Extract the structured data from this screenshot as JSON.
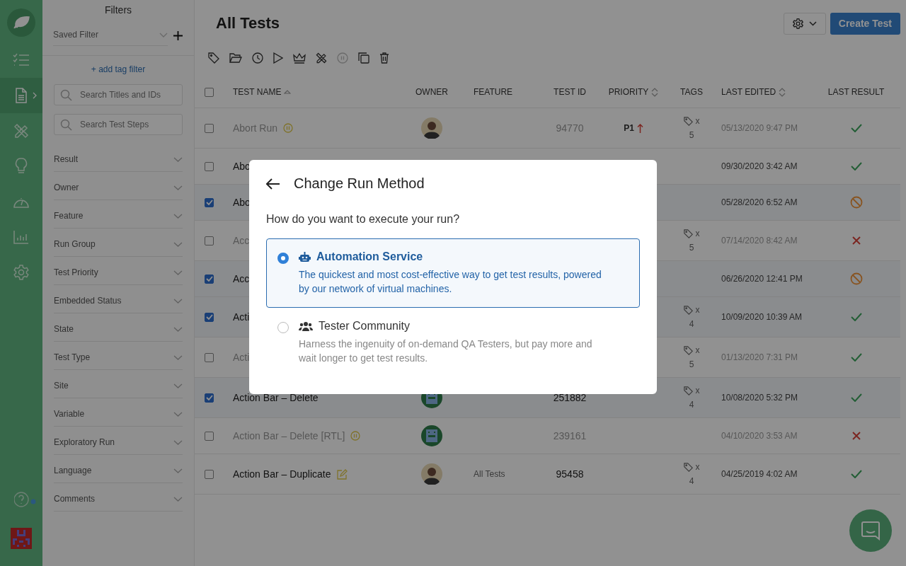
{
  "nav": [
    {
      "selected": false
    },
    {
      "selected": true
    },
    {
      "selected": false
    },
    {
      "selected": false
    },
    {
      "selected": false
    },
    {
      "selected": false
    },
    {
      "selected": false
    }
  ],
  "filters": {
    "title": "Filters",
    "saved_filter": "Saved Filter",
    "add_tag": "+ add tag filter",
    "searches": [
      {
        "placeholder": "Search Titles and IDs"
      },
      {
        "placeholder": "Search Test Steps"
      }
    ],
    "facets": [
      "Result",
      "Owner",
      "Feature",
      "Run Group",
      "Test Priority",
      "Embedded Status",
      "State",
      "Test Type",
      "Site",
      "Variable",
      "Exploratory Run",
      "Language",
      "Comments"
    ]
  },
  "header": {
    "title": "All Tests",
    "create_button": "Create Test"
  },
  "table": {
    "columns": [
      {
        "label": "TEST NAME",
        "sort": {
          "kind": "asc"
        }
      },
      {
        "label": "OWNER"
      },
      {
        "label": "FEATURE"
      },
      {
        "label": "TEST ID"
      },
      {
        "label": "PRIORITY",
        "sort": {
          "kind": "both"
        }
      },
      {
        "label": "TAGS"
      },
      {
        "label": "LAST EDITED",
        "sort": {
          "kind": "both"
        }
      },
      {
        "label": "LAST RESULT"
      }
    ],
    "all_checked": false,
    "rows": [
      {
        "checked": false,
        "muted": true,
        "name": "Abort Run",
        "badge": {
          "kind": "paused"
        },
        "owner": {
          "kind": "photo"
        },
        "test_id": "94770",
        "priority": "P1",
        "tags": {
          "times": "x",
          "count": "5"
        },
        "edited": "05/13/2020 9:47 PM",
        "result": {
          "kind": "pass"
        }
      },
      {
        "checked": false,
        "muted": false,
        "name": "Abo",
        "edited": "09/30/2020 3:42 AM",
        "result": {
          "kind": "pass"
        }
      },
      {
        "checked": true,
        "muted": false,
        "name": "Abo",
        "edited": "05/28/2020 6:52 AM",
        "result": {
          "kind": "blocked"
        }
      },
      {
        "checked": false,
        "muted": true,
        "name": "Acc",
        "tags": {
          "times": "x",
          "count": "5"
        },
        "edited": "07/14/2020 8:42 AM",
        "result": {
          "kind": "fail"
        }
      },
      {
        "checked": true,
        "muted": false,
        "name": "Acc",
        "edited": "06/26/2020 12:41 PM",
        "result": {
          "kind": "blocked"
        }
      },
      {
        "checked": true,
        "muted": false,
        "name": "Acti",
        "tags": {
          "times": "x",
          "count": "4"
        },
        "edited": "10/09/2020 10:39 AM",
        "result": {
          "kind": "pass"
        }
      },
      {
        "checked": false,
        "muted": true,
        "name": "Acti",
        "tags": {
          "times": "x",
          "count": "5"
        },
        "edited": "01/13/2020 7:31 PM",
        "result": {
          "kind": "pass"
        }
      },
      {
        "checked": true,
        "muted": false,
        "name": "Action Bar – Delete",
        "owner": {
          "kind": "robot"
        },
        "test_id": "251882",
        "tags": {
          "times": "x",
          "count": "4"
        },
        "edited": "10/08/2020 5:32 PM",
        "result": {
          "kind": "pass"
        }
      },
      {
        "checked": false,
        "muted": true,
        "name": "Action Bar – Delete [RTL]",
        "badge": {
          "kind": "paused"
        },
        "owner": {
          "kind": "robot"
        },
        "test_id": "239161",
        "edited": "04/10/2020 3:53 AM",
        "result": {
          "kind": "fail"
        }
      },
      {
        "checked": false,
        "muted": false,
        "name": "Action Bar – Duplicate",
        "badge": {
          "kind": "edit"
        },
        "owner": {
          "kind": "photo"
        },
        "feature": "All Tests",
        "test_id": "95458",
        "tags": {
          "times": "x",
          "count": "4"
        },
        "edited": "04/25/2019 4:02 AM",
        "result": {
          "kind": "pass"
        }
      }
    ]
  },
  "modal": {
    "title": "Change Run Method",
    "question": "How do you want to execute your run?",
    "options": [
      {
        "kind": "robot",
        "title": "Automation Service",
        "description": "The quickest and most cost-effective way to get test results, powered by our network of virtual machines.",
        "selected": true
      },
      {
        "kind": "people",
        "title": "Tester Community",
        "description": "Harness the ingenuity of on-demand QA Testers, but pay more and wait longer to get test results.",
        "selected": false
      }
    ]
  }
}
